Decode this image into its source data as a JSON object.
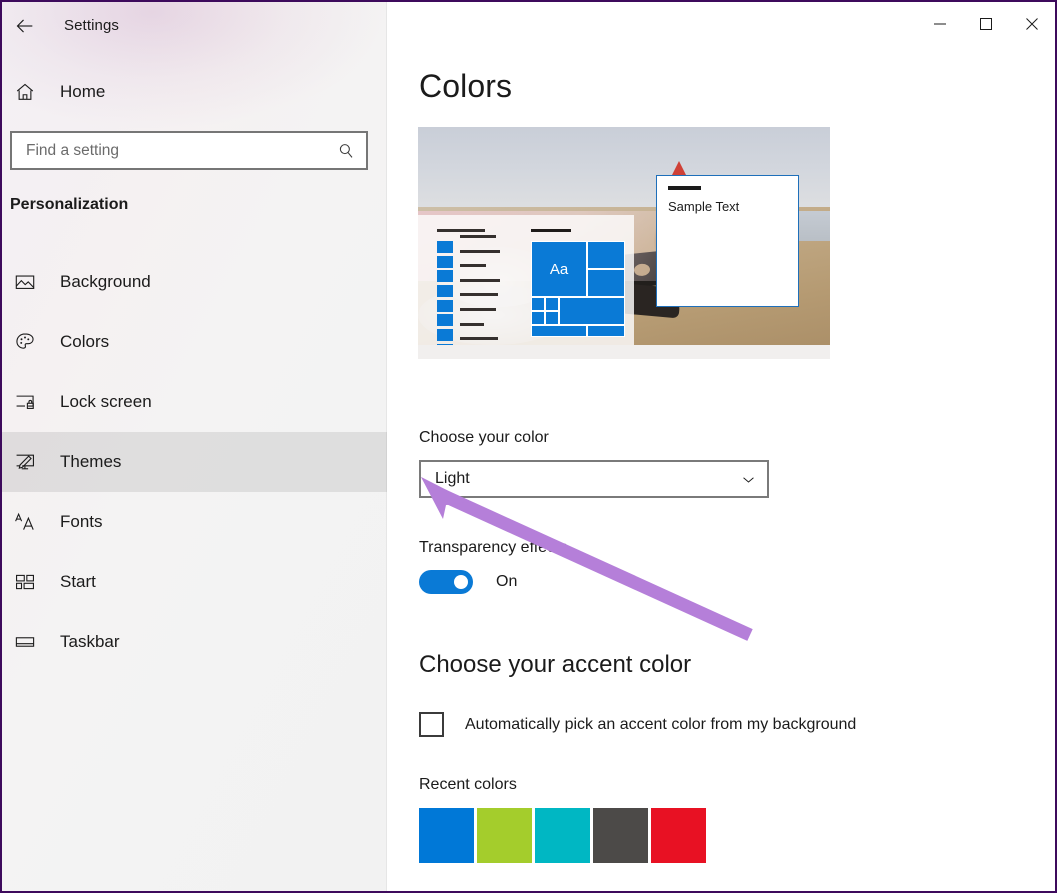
{
  "window": {
    "app_title": "Settings",
    "border_color": "#3d0a5c",
    "controls": {
      "back": "back-arrow",
      "minimize": "minimize",
      "maximize": "maximize",
      "close": "close"
    }
  },
  "sidebar": {
    "home_label": "Home",
    "search": {
      "placeholder": "Find a setting",
      "value": ""
    },
    "category": "Personalization",
    "items": [
      {
        "label": "Background",
        "icon": "picture-icon",
        "selected": false
      },
      {
        "label": "Colors",
        "icon": "palette-icon",
        "selected": false
      },
      {
        "label": "Lock screen",
        "icon": "lock-screen-icon",
        "selected": false
      },
      {
        "label": "Themes",
        "icon": "themes-brush-icon",
        "selected": true
      },
      {
        "label": "Fonts",
        "icon": "fonts-aa-icon",
        "selected": false
      },
      {
        "label": "Start",
        "icon": "start-tiles-icon",
        "selected": false
      },
      {
        "label": "Taskbar",
        "icon": "taskbar-icon",
        "selected": false
      }
    ]
  },
  "main": {
    "page_title": "Colors",
    "preview": {
      "tile_text": "Aa",
      "sample_window_text": "Sample Text",
      "accent_color": "#0a7ad6"
    },
    "choose_color": {
      "label": "Choose your color",
      "selected": "Light",
      "chevron": "chevron-down-icon"
    },
    "transparency": {
      "label": "Transparency effects",
      "state": "On",
      "enabled": true
    },
    "accent_section": {
      "heading": "Choose your accent color",
      "auto_pick_label": "Automatically pick an accent color from my background",
      "auto_pick_checked": false,
      "recent_label": "Recent colors",
      "recent_colors": [
        "#0078D7",
        "#A4CD2C",
        "#00B7C3",
        "#4C4A48",
        "#E81123"
      ]
    }
  },
  "annotation": {
    "arrow_color": "#b57fd9",
    "points_at": "color-dropdown"
  }
}
